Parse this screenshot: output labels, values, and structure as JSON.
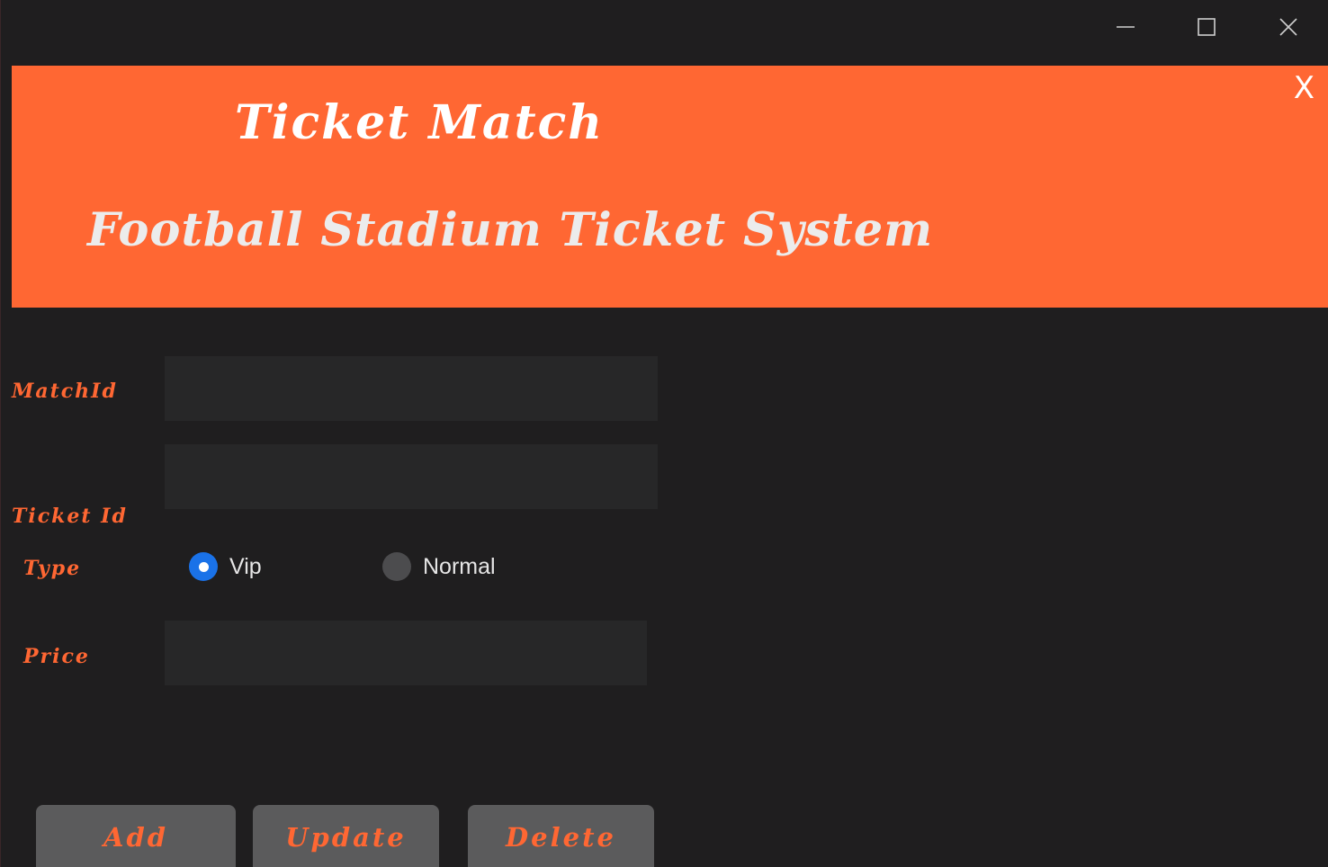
{
  "window": {
    "controls": {
      "minimize_icon": "minimize-icon",
      "maximize_icon": "maximize-icon",
      "close_icon": "close-icon"
    }
  },
  "header": {
    "title": "Ticket Match",
    "subtitle": "Football Stadium Ticket System",
    "close_label": "X",
    "background_color": "#ff6733"
  },
  "form": {
    "match_id": {
      "label": "MatchId",
      "value": ""
    },
    "ticket_id": {
      "label": "Ticket Id",
      "value": ""
    },
    "type": {
      "label": "Type",
      "options": [
        {
          "label": "Vip",
          "checked": true
        },
        {
          "label": "Normal",
          "checked": false
        }
      ]
    },
    "price": {
      "label": "Price",
      "value": ""
    }
  },
  "actions": {
    "add_label": "Add",
    "update_label": "Update",
    "delete_label": "Delete"
  },
  "colors": {
    "accent": "#ff6733",
    "background": "#1f1e1f",
    "field": "#272728",
    "button": "#5b5b5c",
    "radio_selected": "#1a72e8"
  }
}
